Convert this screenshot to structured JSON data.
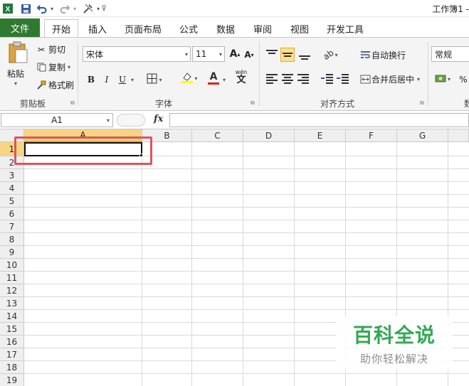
{
  "window": {
    "title": "工作簿1 -"
  },
  "quick_access": {
    "excel_icon": "excel-icon",
    "save_icon": "save-icon",
    "undo_icon": "undo-icon",
    "redo_icon": "redo-icon",
    "customize_icon": "customize-icon"
  },
  "tabs": {
    "file": "文件",
    "items": [
      "开始",
      "插入",
      "页面布局",
      "公式",
      "数据",
      "审阅",
      "视图",
      "开发工具"
    ]
  },
  "ribbon": {
    "clipboard": {
      "paste": "粘贴",
      "cut": "剪切",
      "copy": "复制",
      "format_painter": "格式刷",
      "group_label": "剪贴板"
    },
    "font": {
      "font_name": "宋体",
      "font_size": "11",
      "bold": "B",
      "italic": "I",
      "underline": "U",
      "font_color_letter": "A",
      "phonetic": "wén",
      "group_label": "字体"
    },
    "alignment": {
      "wrap_text": "自动换行",
      "merge_center": "合并后居中",
      "group_label": "对齐方式"
    },
    "number": {
      "format": "常规",
      "percent": "%"
    }
  },
  "formula_bar": {
    "name_box": "A1",
    "fx": "fx",
    "content": ""
  },
  "grid": {
    "columns": [
      "A",
      "B",
      "C",
      "D",
      "E",
      "F",
      "G"
    ],
    "rows": [
      "1",
      "2",
      "3",
      "4",
      "5",
      "6",
      "7",
      "8",
      "9",
      "10",
      "11",
      "12",
      "13",
      "14",
      "15",
      "16",
      "17",
      "18",
      "19"
    ],
    "selected_cell": "A1",
    "highlight_color": "#e0535a"
  },
  "watermark": {
    "main": "百科全说",
    "sub": "助你轻松解决",
    "color": "#33a853"
  },
  "colors": {
    "file_tab": "#2f7a31",
    "selected_header": "#f7d481",
    "font_color_bar": "#e02020",
    "fill_color_bar": "#ffff00"
  }
}
